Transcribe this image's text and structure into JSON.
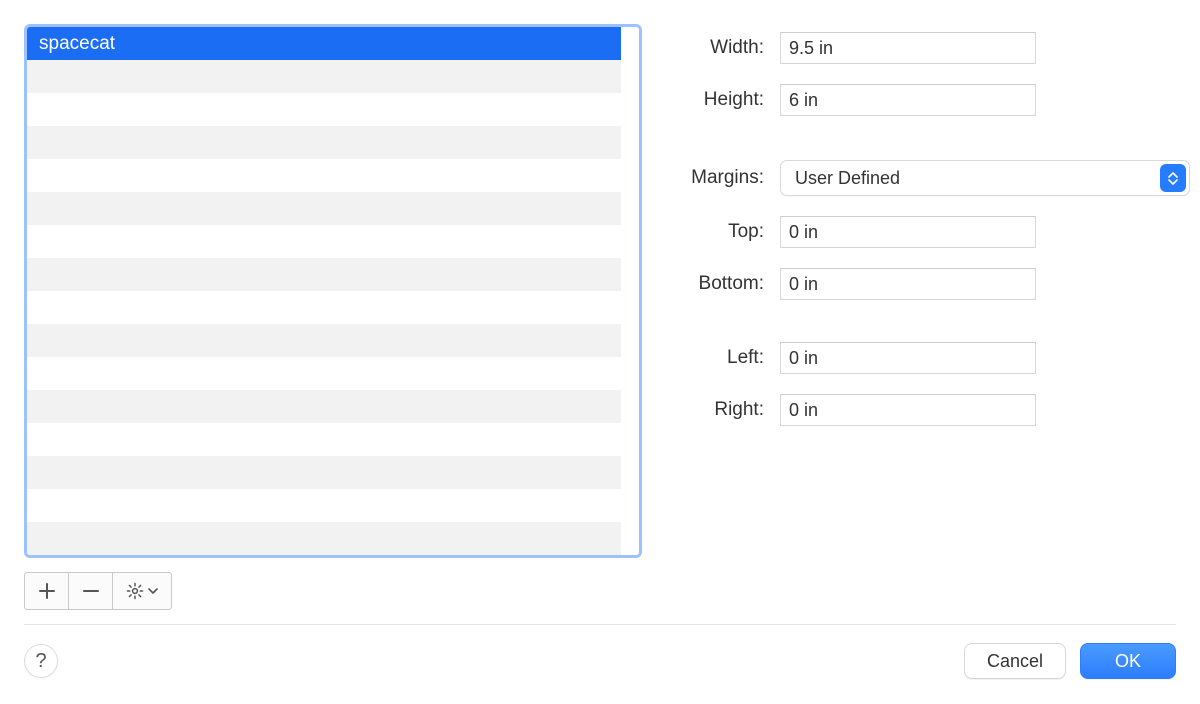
{
  "list": {
    "selected_item": "spacecat"
  },
  "form": {
    "width": {
      "label": "Width:",
      "value": "9.5 in"
    },
    "height": {
      "label": "Height:",
      "value": "6 in"
    },
    "margins": {
      "label": "Margins:",
      "selected": "User Defined"
    },
    "top": {
      "label": "Top:",
      "value": "0 in"
    },
    "bottom": {
      "label": "Bottom:",
      "value": "0 in"
    },
    "left": {
      "label": "Left:",
      "value": "0 in"
    },
    "right": {
      "label": "Right:",
      "value": "0 in"
    }
  },
  "buttons": {
    "help": "?",
    "cancel": "Cancel",
    "ok": "OK"
  }
}
